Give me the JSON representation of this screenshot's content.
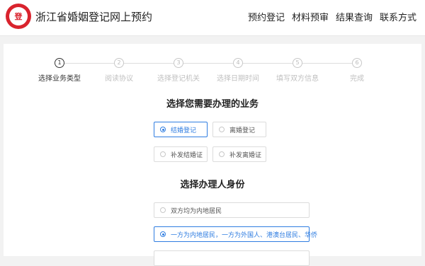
{
  "header": {
    "logo_text": "登",
    "title": "浙江省婚姻登记网上预约",
    "nav": [
      "预约登记",
      "材料预审",
      "结果查询",
      "联系方式"
    ]
  },
  "steps": [
    {
      "num": "1",
      "label": "选择业务类型",
      "active": true
    },
    {
      "num": "2",
      "label": "阅读协议",
      "active": false
    },
    {
      "num": "3",
      "label": "选择登记机关",
      "active": false
    },
    {
      "num": "4",
      "label": "选择日期时间",
      "active": false
    },
    {
      "num": "5",
      "label": "填写双方信息",
      "active": false
    },
    {
      "num": "6",
      "label": "完成",
      "active": false
    }
  ],
  "business": {
    "title": "选择您需要办理的业务",
    "options": [
      {
        "label": "结婚登记",
        "selected": true
      },
      {
        "label": "离婚登记",
        "selected": false
      },
      {
        "label": "补发结婚证",
        "selected": false
      },
      {
        "label": "补发离婚证",
        "selected": false
      }
    ]
  },
  "identity": {
    "title": "选择办理人身份",
    "options": [
      {
        "label": "双方均为内地居民",
        "selected": false
      },
      {
        "label": "一方为内地居民，一方为外国人、港澳台居民、华侨",
        "selected": true
      }
    ]
  },
  "colors": {
    "accent": "#2f7de1",
    "brand": "#d9232d"
  }
}
